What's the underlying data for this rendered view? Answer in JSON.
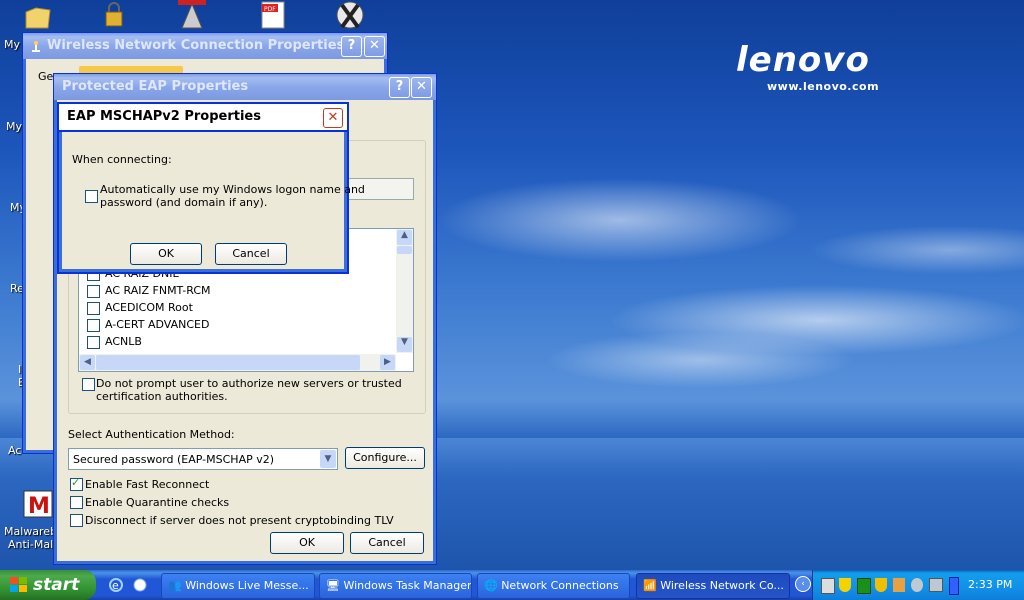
{
  "desktop": {
    "brand": "lenovo",
    "brand_url": "www.lenovo.com",
    "icons": [
      {
        "label": "My I",
        "icon": "documents-folder-icon"
      },
      {
        "label": "My",
        "icon": "computer-icon"
      },
      {
        "label": "My",
        "icon": "network-icon"
      },
      {
        "label": "Re",
        "icon": "recycle-bin-icon"
      },
      {
        "label": "I",
        "icon": "app-icon"
      },
      {
        "label": "E",
        "icon": "app-icon"
      },
      {
        "label": "Ac",
        "icon": "app-icon"
      },
      {
        "label": "Malwareb",
        "icon": "malwarebytes-icon"
      },
      {
        "label": "Anti-Malw",
        "icon": "malwarebytes-icon"
      }
    ]
  },
  "wireless_window": {
    "title": "Wireless Network Connection Properties",
    "tab_label": "Ge"
  },
  "peap_window": {
    "title": "Protected EAP Properties",
    "cert_list": [
      "AC RAIZ DNIE",
      "AC RAIZ FNMT-RCM",
      "ACEDICOM Root",
      "A-CERT ADVANCED",
      "ACNLB"
    ],
    "do_not_prompt_line1": "Do not prompt user to authorize new servers or trusted",
    "do_not_prompt_line2": "certification authorities.",
    "select_auth_label": "Select Authentication Method:",
    "auth_method": "Secured password (EAP-MSCHAP v2)",
    "configure_button": "Configure...",
    "fast_reconnect": "Enable Fast Reconnect",
    "quarantine": "Enable Quarantine checks",
    "disconnect": "Disconnect if server does not present cryptobinding TLV",
    "ok_button": "OK",
    "cancel_button": "Cancel"
  },
  "mschap_dialog": {
    "title": "EAP MSCHAPv2 Properties",
    "when_connecting": "When connecting:",
    "auto_logon_line1": "Automatically use my Windows logon name and",
    "auto_logon_line2": "password (and domain if any).",
    "ok_button": "OK",
    "cancel_button": "Cancel"
  },
  "taskbar": {
    "start_label": "start",
    "tasks": [
      {
        "label": "Windows Live Messe...",
        "icon": "messenger-icon"
      },
      {
        "label": "Windows Task Manager",
        "icon": "task-manager-icon"
      },
      {
        "label": "Network Connections",
        "icon": "network-connections-icon"
      },
      {
        "label": "Wireless Network Co...",
        "icon": "wireless-icon"
      }
    ],
    "clock": "2:33 PM"
  }
}
